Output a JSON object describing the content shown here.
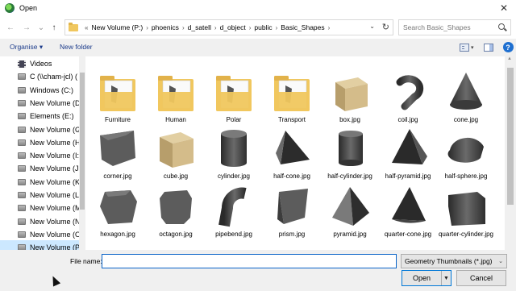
{
  "window": {
    "title": "Open",
    "close_glyph": "✕"
  },
  "nav": {
    "back_glyph": "←",
    "forward_glyph": "→",
    "recent_glyph": "⌄",
    "up_glyph": "↑",
    "breadcrumb_prefix": "«",
    "breadcrumbs": [
      "New Volume (P:)",
      "phoenics",
      "d_satell",
      "d_object",
      "public",
      "Basic_Shapes"
    ],
    "refresh_glyph": "↻",
    "search_placeholder": "Search Basic_Shapes"
  },
  "toolbar": {
    "organise_label": "Organise ▾",
    "new_folder_label": "New folder",
    "help_glyph": "?"
  },
  "sidebar": {
    "items": [
      {
        "label": "Videos",
        "icon": "video-icon"
      },
      {
        "label": "C (\\\\cham-jcl) (",
        "icon": "drive-icon"
      },
      {
        "label": "Windows (C:)",
        "icon": "drive-icon"
      },
      {
        "label": "New Volume (D:",
        "icon": "drive-icon"
      },
      {
        "label": "Elements (E:)",
        "icon": "drive-icon"
      },
      {
        "label": "New Volume (G:",
        "icon": "drive-icon"
      },
      {
        "label": "New Volume (H:",
        "icon": "drive-icon"
      },
      {
        "label": "New Volume (I:)",
        "icon": "drive-icon"
      },
      {
        "label": "New Volume (J:)",
        "icon": "drive-icon"
      },
      {
        "label": "New Volume (K:",
        "icon": "drive-icon"
      },
      {
        "label": "New Volume (L:)",
        "icon": "drive-icon"
      },
      {
        "label": "New Volume (M",
        "icon": "drive-icon"
      },
      {
        "label": "New Volume (N:",
        "icon": "drive-icon"
      },
      {
        "label": "New Volume (O:",
        "icon": "drive-icon"
      },
      {
        "label": "New Volume (P:",
        "icon": "drive-icon",
        "selected": true
      }
    ]
  },
  "files": [
    {
      "label": "Furniture",
      "kind": "folder"
    },
    {
      "label": "Human",
      "kind": "folder"
    },
    {
      "label": "Polar",
      "kind": "folder"
    },
    {
      "label": "Transport",
      "kind": "folder"
    },
    {
      "label": "box.jpg",
      "kind": "box"
    },
    {
      "label": "coil.jpg",
      "kind": "coil"
    },
    {
      "label": "cone.jpg",
      "kind": "cone"
    },
    {
      "label": "corner.jpg",
      "kind": "corner"
    },
    {
      "label": "cube.jpg",
      "kind": "cube"
    },
    {
      "label": "cylinder.jpg",
      "kind": "cylinder"
    },
    {
      "label": "half-cone.jpg",
      "kind": "half-cone"
    },
    {
      "label": "half-cylinder.jpg",
      "kind": "half-cylinder"
    },
    {
      "label": "half-pyramid.jpg",
      "kind": "half-pyramid"
    },
    {
      "label": "half-sphere.jpg",
      "kind": "half-sphere"
    },
    {
      "label": "hexagon.jpg",
      "kind": "hexagon"
    },
    {
      "label": "octagon.jpg",
      "kind": "octagon"
    },
    {
      "label": "pipebend.jpg",
      "kind": "pipebend"
    },
    {
      "label": "prism.jpg",
      "kind": "prism"
    },
    {
      "label": "pyramid.jpg",
      "kind": "pyramid"
    },
    {
      "label": "quarter-cone.jpg",
      "kind": "quarter-cone"
    },
    {
      "label": "quarter-cylinder.jpg",
      "kind": "quarter-cylinder"
    }
  ],
  "footer": {
    "filename_label": "File name:",
    "filename_value": "",
    "filetype_value": "Geometry Thumbnails (*.jpg)",
    "open_label": "Open",
    "cancel_label": "Cancel"
  },
  "colors": {
    "folder": "#f0c75e",
    "selection": "#cce8ff",
    "accent": "#0078d7",
    "shape_gray": "#5c5c5c",
    "box_tan": "#d4bc8a"
  }
}
